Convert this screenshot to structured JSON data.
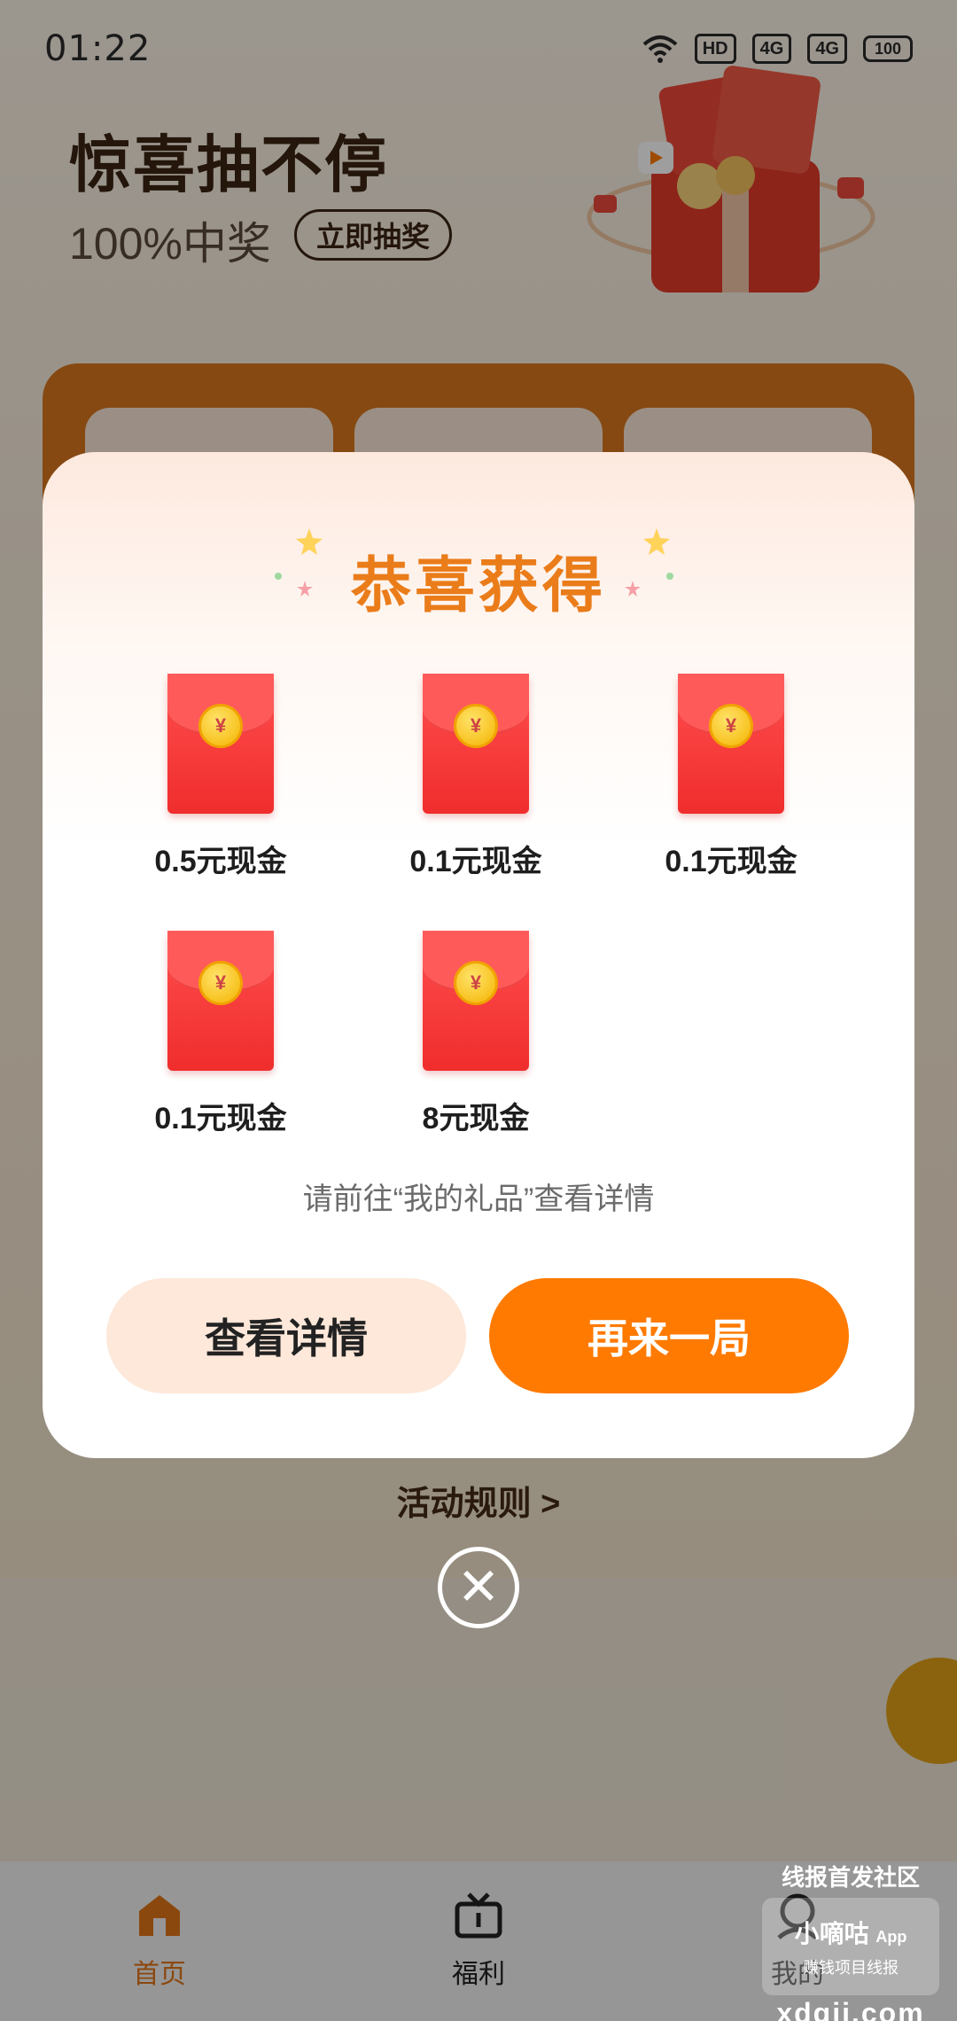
{
  "status_bar": {
    "time": "01:22",
    "hd": "HD",
    "net1": "4G",
    "net2": "4G",
    "battery": "100"
  },
  "hero": {
    "title": "惊喜抽不停",
    "subtitle": "100%中奖",
    "cta": "立即抽奖"
  },
  "dialog": {
    "title": "恭喜获得",
    "currency_symbol": "¥",
    "prizes": [
      {
        "label": "0.5元现金"
      },
      {
        "label": "0.1元现金"
      },
      {
        "label": "0.1元现金"
      },
      {
        "label": "0.1元现金"
      },
      {
        "label": "8元现金"
      }
    ],
    "note": "请前往“我的礼品”查看详情",
    "detail_button": "查看详情",
    "again_button": "再来一局"
  },
  "rules_link": "活动规则 >",
  "close_glyph": "✕",
  "bottom_nav": {
    "items": [
      {
        "label": "首页",
        "icon": "home-icon",
        "active": true
      },
      {
        "label": "福利",
        "icon": "tv-icon",
        "active": false
      },
      {
        "label": "我的",
        "icon": "profile-icon",
        "active": false
      }
    ]
  },
  "watermark": {
    "top": "线报首发社区",
    "name": "小嘀咕",
    "tag": "App",
    "slogan": "赚钱项目线报",
    "domain": "xdgii.com"
  },
  "colors": {
    "accent": "#ff7a00",
    "title": "#ea7c1a",
    "envelope": "#f02d2d"
  }
}
